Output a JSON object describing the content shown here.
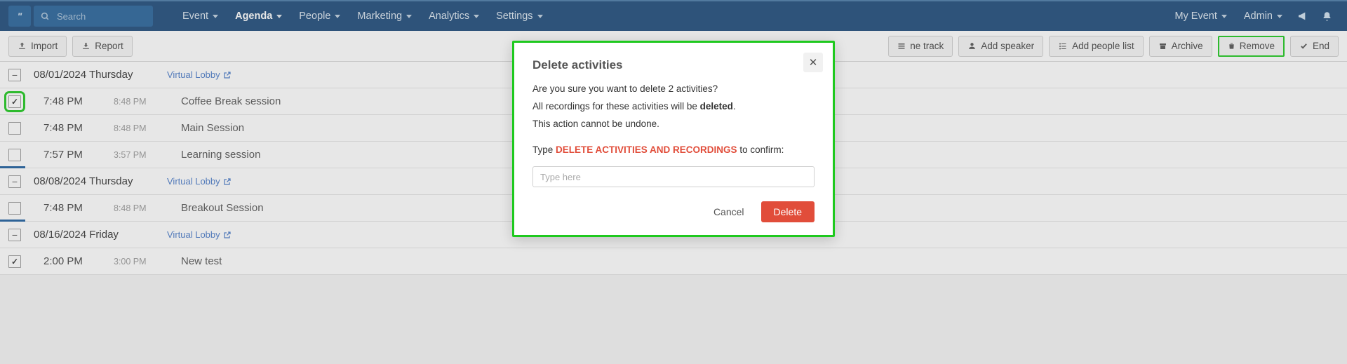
{
  "nav": {
    "search_placeholder": "Search",
    "items": [
      {
        "label": "Event"
      },
      {
        "label": "Agenda"
      },
      {
        "label": "People"
      },
      {
        "label": "Marketing"
      },
      {
        "label": "Analytics"
      },
      {
        "label": "Settings"
      }
    ],
    "right_event": "My Event",
    "right_user": "Admin"
  },
  "toolbar": {
    "import_label": "Import",
    "report_label": "Report",
    "right": [
      {
        "label": "ne track",
        "icon": "track"
      },
      {
        "label": "Add speaker",
        "icon": "speaker"
      },
      {
        "label": "Add people list",
        "icon": "list"
      },
      {
        "label": "Archive",
        "icon": "archive"
      },
      {
        "label": "Remove",
        "icon": "trash",
        "highlight": true
      },
      {
        "label": "End",
        "icon": "check"
      }
    ]
  },
  "agenda": {
    "days": [
      {
        "date": "08/01/2024 Thursday",
        "lobby": "Virtual Lobby",
        "sessions": [
          {
            "start": "7:48 PM",
            "end": "8:48 PM",
            "title": "Coffee Break session",
            "checked": true,
            "highlight": true,
            "bluebar": false
          },
          {
            "start": "7:48 PM",
            "end": "8:48 PM",
            "title": "Main Session",
            "checked": false,
            "highlight": false,
            "bluebar": false
          },
          {
            "start": "7:57 PM",
            "end": "3:57 PM",
            "title": "Learning session",
            "checked": false,
            "highlight": false,
            "bluebar": true
          }
        ]
      },
      {
        "date": "08/08/2024 Thursday",
        "lobby": "Virtual Lobby",
        "sessions": [
          {
            "start": "7:48 PM",
            "end": "8:48 PM",
            "title": "Breakout Session",
            "checked": false,
            "highlight": false,
            "bluebar": true
          }
        ]
      },
      {
        "date": "08/16/2024 Friday",
        "lobby": "Virtual Lobby",
        "sessions": [
          {
            "start": "2:00 PM",
            "end": "3:00 PM",
            "title": "New test",
            "checked": true,
            "highlight": false,
            "bluebar": false
          }
        ]
      }
    ]
  },
  "modal": {
    "title": "Delete activities",
    "line1": "Are you sure you want to delete 2 activities?",
    "line2_pre": "All recordings for these activities will be ",
    "line2_strong": "deleted",
    "line2_post": ".",
    "line3": "This action cannot be undone.",
    "confirm_pre": "Type ",
    "confirm_phrase": "DELETE ACTIVITIES AND RECORDINGS",
    "confirm_post": " to confirm:",
    "input_placeholder": "Type here",
    "cancel": "Cancel",
    "delete": "Delete"
  }
}
